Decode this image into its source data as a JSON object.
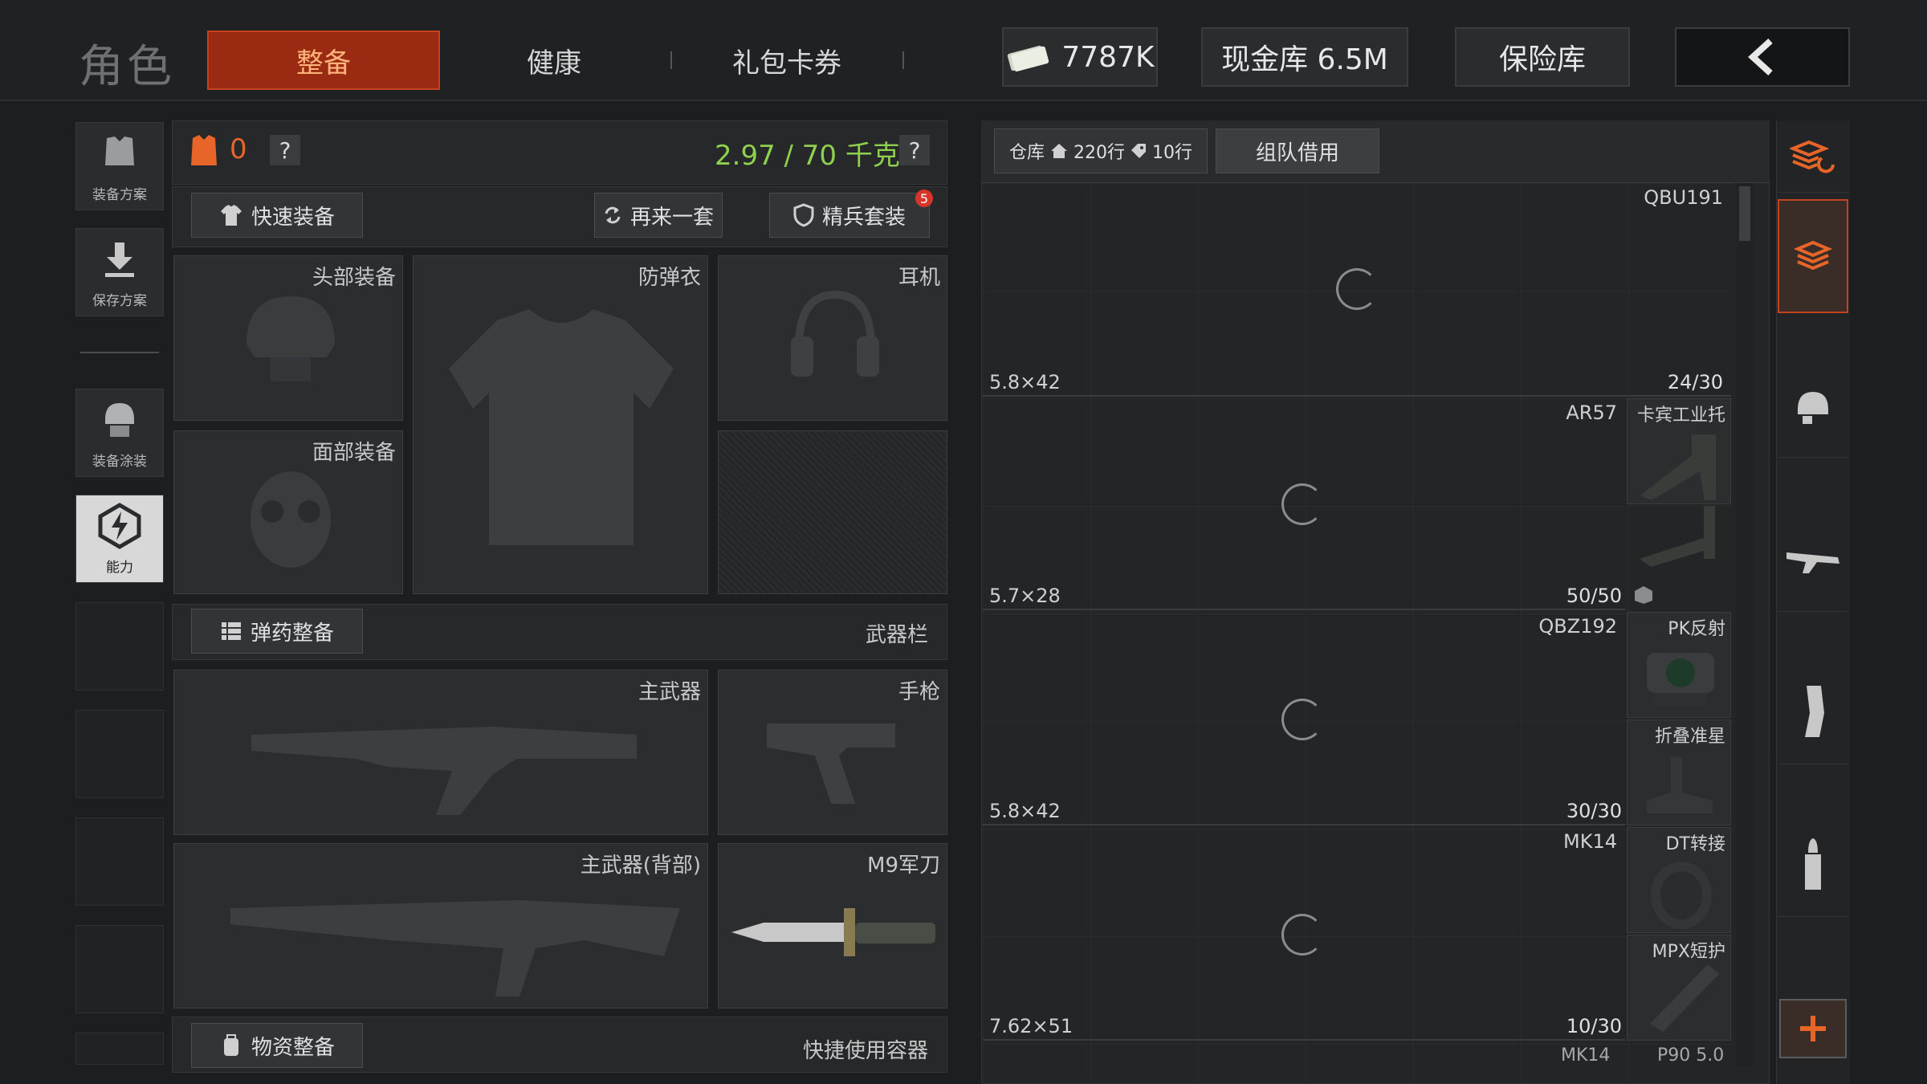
{
  "header": {
    "title": "角色",
    "tabs": [
      {
        "label": "整备",
        "active": true
      },
      {
        "label": "健康",
        "active": false
      },
      {
        "label": "礼包卡券",
        "active": false
      }
    ],
    "money": "7787K",
    "cash_vault": "现金库 6.5M",
    "safe_box": "保险库"
  },
  "left_nav": [
    {
      "label": "装备方案",
      "icon": "armor-plan-icon"
    },
    {
      "label": "保存方案",
      "icon": "save-download-icon"
    },
    {
      "label": "装备涂装",
      "icon": "helmet-paint-icon"
    },
    {
      "label": "能力",
      "icon": "ability-bolt-icon",
      "active": true
    }
  ],
  "loadout": {
    "armor_count": "0",
    "help": "?",
    "weight": "2.97 / 70 千克",
    "quick_equip": "快速装备",
    "again": "再来一套",
    "elite_set": "精兵套装",
    "elite_badge": "5",
    "slots": {
      "head": "头部装备",
      "vest": "防弹衣",
      "headset": "耳机",
      "face": "面部装备",
      "primary": "主武器",
      "pistol": "手枪",
      "primary_back": "主武器(背部)",
      "knife": "M9军刀"
    },
    "ammo_btn": "弹药整备",
    "weapon_bar": "武器栏",
    "supply_btn": "物资整备",
    "quick_container": "快捷使用容器"
  },
  "warehouse": {
    "tab_label": "仓库",
    "rows_home": "220行",
    "rows_tag": "10行",
    "team_borrow": "组队借用",
    "weapons": [
      {
        "name": "QBU191",
        "caliber": "5.8×42",
        "ammo": "24/30"
      },
      {
        "name": "AR57",
        "caliber": "5.7×28",
        "ammo": "50/50"
      },
      {
        "name": "QBZ192",
        "caliber": "5.8×42",
        "ammo": "30/30"
      },
      {
        "name": "MK14",
        "caliber": "7.62×51",
        "ammo": "10/30"
      }
    ],
    "attachments": [
      "卡宾工业托",
      "PK反射",
      "折叠准星",
      "DT转接",
      "MPX短护"
    ],
    "partial_row": [
      "MK14",
      "P90 5.0"
    ]
  },
  "colors": {
    "accent": "#c4421e",
    "weight_green": "#8fd14f",
    "armor_orange": "#e8652a"
  }
}
